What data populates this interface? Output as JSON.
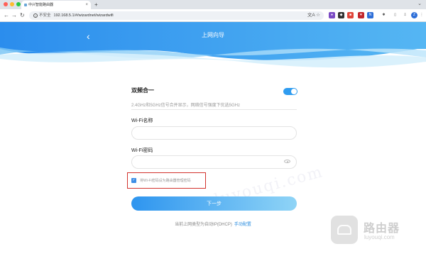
{
  "browser": {
    "tab_title": "中兴智能路由器",
    "new_tab": "+",
    "security_label": "不安全",
    "url": "192.168.5.1/#/wizardnet/wizardwifi"
  },
  "header": {
    "back_icon": "chevron-left-icon",
    "title": "上网向导"
  },
  "form": {
    "dual_band_title": "双频合一",
    "dual_band_enabled": true,
    "dual_band_desc": "2.4GHz和5GHz信号合并显示，网络信号强度下优选5GHz",
    "ssid_label": "Wi-Fi名称",
    "ssid_value": "",
    "password_label": "Wi-Fi密码",
    "password_value": "",
    "sync_checkbox_label": "将Wi-Fi密码设为路由器管理密码",
    "sync_checked": true,
    "next_button": "下一步"
  },
  "footer": {
    "text": "当前上网类型为自动IP(DHCP)",
    "manual_link": "手动配置"
  },
  "watermark": {
    "brand": "路由器",
    "domain": "luyouqi.com",
    "diagonal": "luyouqi.com"
  },
  "colors": {
    "accent": "#2f9cf0",
    "highlight_border": "#d2322d"
  }
}
